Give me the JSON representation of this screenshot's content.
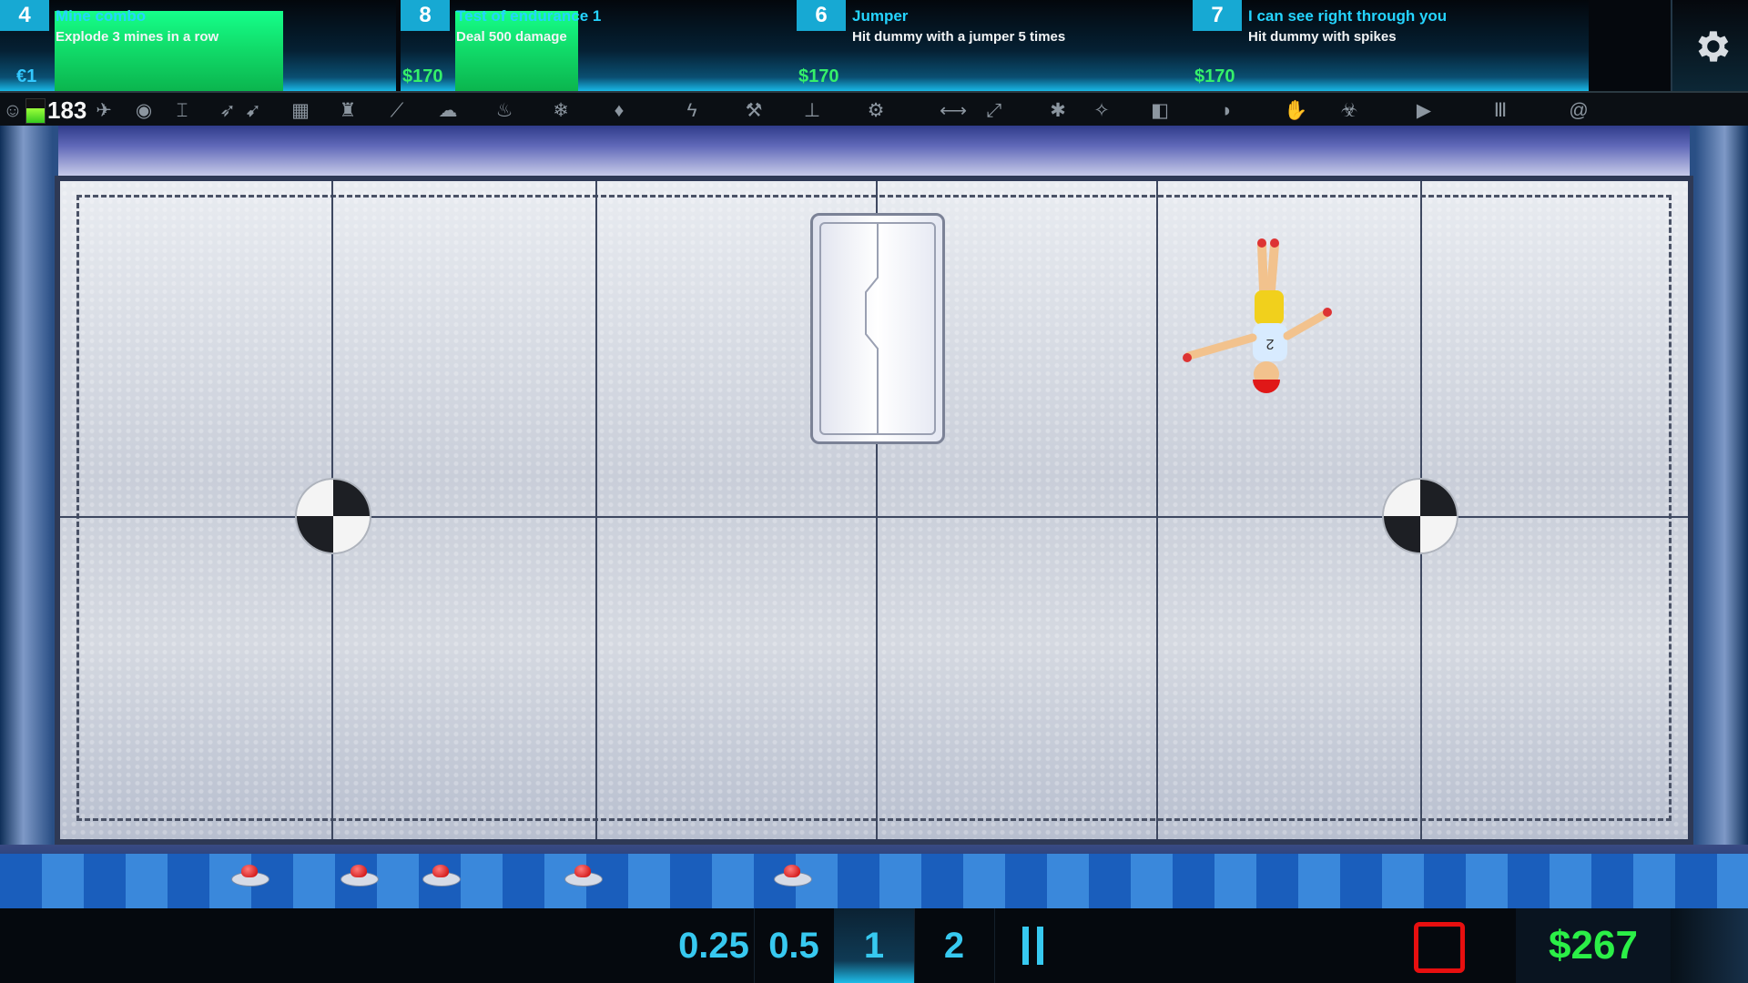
{
  "achievements": [
    {
      "level": "4",
      "name": "Mine combo",
      "description": "Explode 3 mines in a row",
      "reward": "€1",
      "reward_color": "#33c8ff",
      "progress": 0.67
    },
    {
      "level": "8",
      "name": "Test of endurance 1",
      "description": "Deal 500 damage",
      "reward": "$170",
      "reward_color": "#35f06a",
      "progress": 0.36
    },
    {
      "level": "6",
      "name": "Jumper",
      "description": "Hit dummy with a jumper 5 times",
      "reward": "$170",
      "reward_color": "#35f06a",
      "progress": 0.0
    },
    {
      "level": "7",
      "name": "I can see right through you",
      "description": "Hit dummy with spikes",
      "reward": "$170",
      "reward_color": "#35f06a",
      "progress": 0.0
    }
  ],
  "settings": {
    "icon": "gear-icon"
  },
  "toolbar": {
    "health_value": "183",
    "health_level": 0.6,
    "icons": [
      "person-icon",
      "airplane-icon",
      "circle-saw-icon",
      "spring-icon",
      "rocket-icon",
      "missile-icon",
      "grid-icon",
      "candle-icon",
      "knife-icon",
      "brain-icon",
      "fire-icon",
      "snowflake-icon",
      "water-drop-icon",
      "lightning-icon",
      "hammer-icon",
      "needle-icon",
      "gear-wheel-icon",
      "arrow-icon",
      "wrench-icon",
      "claw-icon",
      "fan-icon",
      "blade-icon",
      "speaker-icon",
      "glove-icon",
      "hand-icon",
      "virus-icon",
      "camera-icon",
      "tower-icon",
      "swirl-icon"
    ]
  },
  "arena": {
    "accent_colors": {
      "target_dark": "#1d1f24",
      "target_light": "#f4f4f4",
      "mine_red": "#c70000"
    }
  },
  "bottom_bar": {
    "speeds": [
      "0.25",
      "0.5",
      "1",
      "2"
    ],
    "active_speed": "1",
    "pause_icon": "pause-icon",
    "stop_icon": "stop-icon",
    "money": "$267"
  }
}
